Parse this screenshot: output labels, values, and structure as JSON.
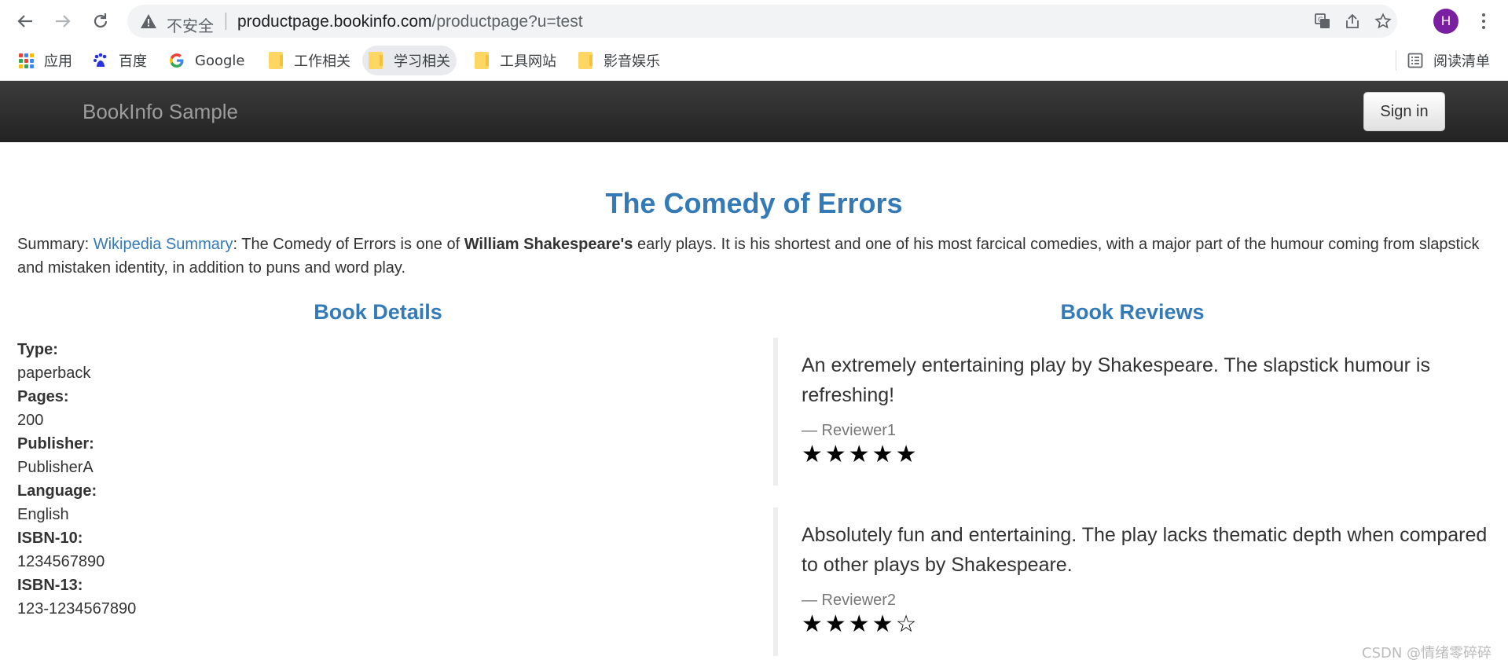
{
  "browser": {
    "security_label": "不安全",
    "url_host": "productpage.bookinfo.com",
    "url_path": "/productpage?u=test",
    "avatar_letter": "H",
    "bookmarks": [
      {
        "label": "应用",
        "icon": "apps-grid-icon"
      },
      {
        "label": "百度",
        "icon": "baidu-paw-icon"
      },
      {
        "label": "Google",
        "icon": "google-g-icon"
      },
      {
        "label": "工作相关",
        "icon": "folder-icon"
      },
      {
        "label": "学习相关",
        "icon": "folder-icon"
      },
      {
        "label": "工具网站",
        "icon": "folder-icon"
      },
      {
        "label": "影音娱乐",
        "icon": "folder-icon"
      }
    ],
    "reading_list_label": "阅读清单"
  },
  "navbar": {
    "brand": "BookInfo Sample",
    "signin_label": "Sign in"
  },
  "book": {
    "title": "The Comedy of Errors",
    "summary_prefix": "Summary: ",
    "summary_link": "Wikipedia Summary",
    "summary_mid": ": The Comedy of Errors is one of ",
    "summary_bold": "William Shakespeare's",
    "summary_rest": " early plays. It is his shortest and one of his most farcical comedies, with a major part of the humour coming from slapstick and mistaken identity, in addition to puns and word play."
  },
  "details": {
    "heading": "Book Details",
    "items": [
      {
        "key": "Type:",
        "value": "paperback"
      },
      {
        "key": "Pages:",
        "value": "200"
      },
      {
        "key": "Publisher:",
        "value": "PublisherA"
      },
      {
        "key": "Language:",
        "value": "English"
      },
      {
        "key": "ISBN-10:",
        "value": "1234567890"
      },
      {
        "key": "ISBN-13:",
        "value": "123-1234567890"
      }
    ]
  },
  "reviews": {
    "heading": "Book Reviews",
    "items": [
      {
        "text": "An extremely entertaining play by Shakespeare. The slapstick humour is refreshing!",
        "reviewer": "— Reviewer1",
        "stars": "★★★★★",
        "rating": 5
      },
      {
        "text": "Absolutely fun and entertaining. The play lacks thematic depth when compared to other plays by Shakespeare.",
        "reviewer": "— Reviewer2",
        "stars": "★★★★☆",
        "rating": 4
      }
    ]
  },
  "watermark": "CSDN @情绪零碎碎",
  "colors": {
    "link": "#337ab7",
    "navbar_dark": "#222222",
    "avatar": "#7b1fa2"
  }
}
